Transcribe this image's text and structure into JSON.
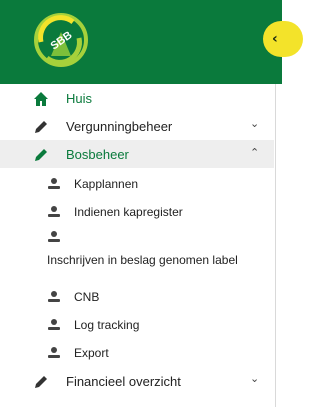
{
  "colors": {
    "brand_green": "#0a7a3c",
    "accent_yellow": "#f3e32a",
    "active_bg": "#eeeeee"
  },
  "header": {
    "logo_text": "SBB",
    "collapse_icon": "chevron-left-icon"
  },
  "menu": {
    "home": {
      "label": "Huis",
      "icon": "home-icon"
    },
    "vergunning": {
      "label": "Vergunningbeheer",
      "icon": "pencil-icon",
      "state": "collapsed"
    },
    "bosbeheer": {
      "label": "Bosbeheer",
      "icon": "pencil-icon",
      "state": "expanded"
    },
    "sub": [
      {
        "label": "Kapplannen",
        "icon": "person-icon"
      },
      {
        "label": "Indienen kapregister",
        "icon": "person-icon"
      },
      {
        "label": "Inschrijven in beslag genomen label",
        "icon": "person-icon"
      },
      {
        "label": "CNB",
        "icon": "person-icon"
      },
      {
        "label": "Log tracking",
        "icon": "person-icon"
      },
      {
        "label": "Export",
        "icon": "person-icon"
      }
    ],
    "financieel": {
      "label": "Financieel overzicht",
      "icon": "pencil-icon",
      "state": "collapsed"
    }
  }
}
